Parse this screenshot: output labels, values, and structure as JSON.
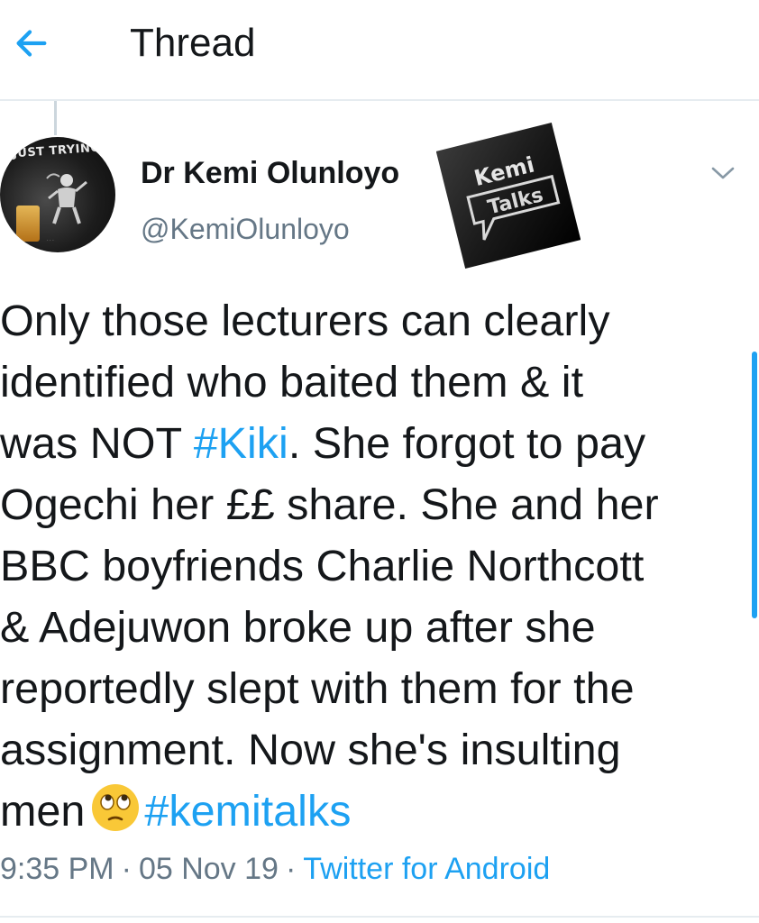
{
  "header": {
    "back_icon": "arrow-left-icon",
    "title": "Thread"
  },
  "tweet": {
    "avatar": {
      "icon": "profile-avatar",
      "badge_text": "JUST TRYING"
    },
    "author_name": "Dr Kemi Olunloyo",
    "author_handle": "@KemiOlunloyo",
    "brand_logo": {
      "line1": "Kemi",
      "line2": "Talks"
    },
    "menu_icon": "chevron-down-icon",
    "text": {
      "line1": "Only those lecturers can clearly",
      "line2": "identified who baited them & it",
      "line3_a": "was NOT ",
      "line3_hashtag": "#Kiki",
      "line3_b": ". She forgot to pay",
      "line4": "Ogechi her ££ share. She and her",
      "line5": "BBC boyfriends Charlie Northcott",
      "line6": "& Adejuwon broke up after she",
      "line7": "reportedly slept with them for the",
      "line8": "assignment. Now she's insulting",
      "line9_a": "men",
      "line9_emoji": "face-with-rolling-eyes-emoji",
      "line9_hashtag": "#kemitalks"
    },
    "meta": {
      "time": "9:35 PM",
      "separator": "·",
      "date": "05 Nov 19",
      "source": "Twitter for Android"
    }
  },
  "colors": {
    "accent": "#1da1f2",
    "text": "#14171a",
    "secondary": "#657786",
    "divider": "#e6ecf0"
  }
}
